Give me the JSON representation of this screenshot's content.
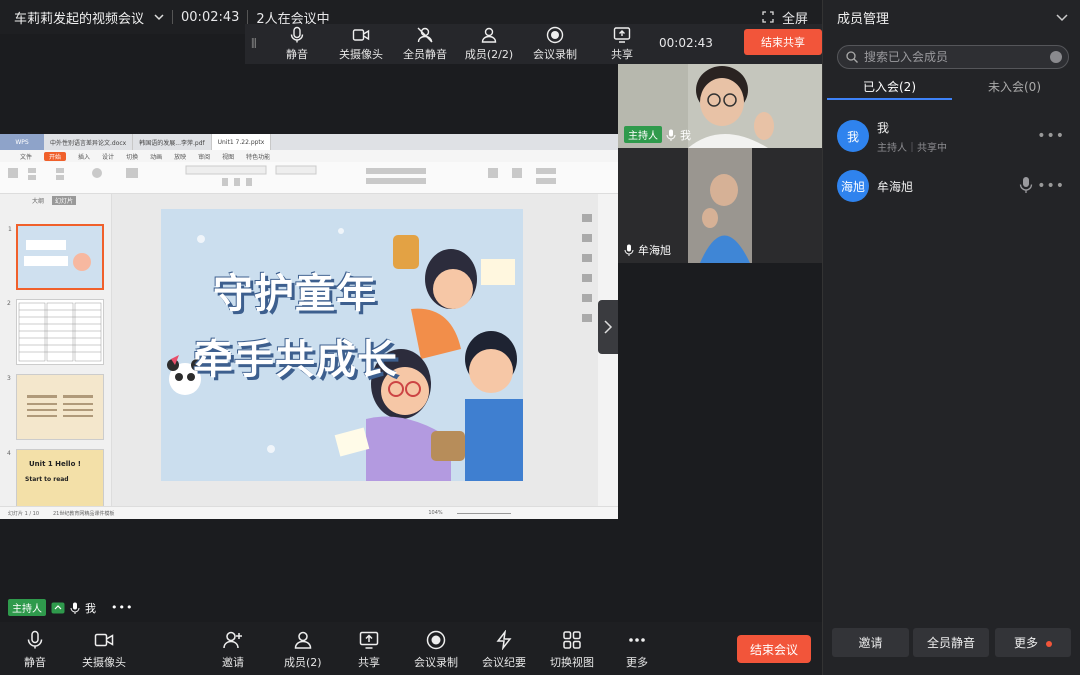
{
  "topbar": {
    "title": "车莉莉发起的视频会议",
    "timer": "00:02:43",
    "participants_status": "2人在会议中",
    "fullscreen_label": "全屏"
  },
  "sharebar": {
    "mute": "静音",
    "camera_off": "关摄像头",
    "mute_all": "全员静音",
    "members": "成员(2/2)",
    "record": "会议录制",
    "share": "共享",
    "timer": "00:02:43",
    "end_share": "结束共享"
  },
  "shared_screen": {
    "tabs": [
      {
        "label": "WPS"
      },
      {
        "label": "中外性别语言差异论文.docx"
      },
      {
        "label": "韩国语的发展...李萍.pdf"
      },
      {
        "label": "Unit1  7.22.pptx"
      }
    ],
    "menu": [
      "文件",
      "开始",
      "插入",
      "设计",
      "切换",
      "动画",
      "放映",
      "审阅",
      "视图",
      "特色功能"
    ],
    "active_menu": "开始",
    "pane_tabs": [
      "大纲",
      "幻灯片"
    ],
    "thumb_numbers": [
      "1",
      "2",
      "3",
      "4"
    ],
    "thumb4_text": "Unit 1  Hello !",
    "thumb4_sub": "Start to read",
    "slide_title_1": "守护童年",
    "slide_title_2": "牵手共成长",
    "status_page": "幻灯片 1 / 10",
    "status_theme": "21世纪教育网精品课件模板",
    "status_zoom": "104%"
  },
  "tiles": {
    "me": {
      "name": "我",
      "role": "主持人"
    },
    "other": {
      "name": "牟海旭"
    }
  },
  "bottom_tag": {
    "role": "主持人",
    "name": "我"
  },
  "toolbar": {
    "mute": "静音",
    "camera_off": "关摄像头",
    "invite": "邀请",
    "members": "成员(2)",
    "share": "共享",
    "record": "会议录制",
    "minutes": "会议纪要",
    "switch_view": "切换视图",
    "more": "更多",
    "end_meeting": "结束会议"
  },
  "panel": {
    "title": "成员管理",
    "search_placeholder": "搜索已入会成员",
    "tab_joined": "已入会(2)",
    "tab_not_joined": "未入会(0)",
    "members": [
      {
        "avatar": "我",
        "name": "我",
        "sub": "主持人｜共享中"
      },
      {
        "avatar": "海旭",
        "name": "牟海旭",
        "sub": ""
      }
    ],
    "invite": "邀请",
    "mute_all": "全员静音",
    "more": "更多"
  },
  "colors": {
    "accent_red": "#f2553a",
    "accent_blue": "#3e82f7",
    "host_green": "#2f9a4c"
  }
}
